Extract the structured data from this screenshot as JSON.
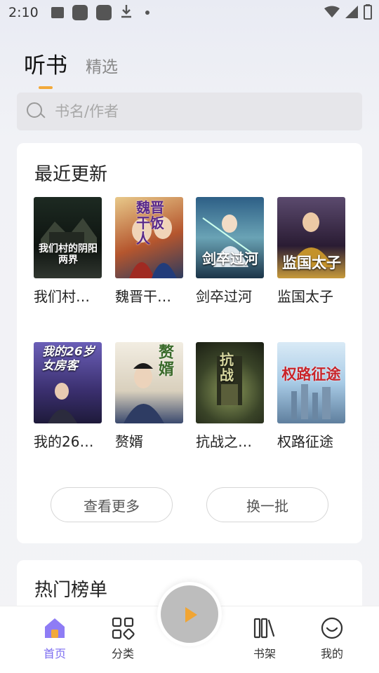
{
  "status_bar": {
    "time": "2:10"
  },
  "tabs": [
    {
      "label": "听书",
      "active": true
    },
    {
      "label": "精选",
      "active": false
    }
  ],
  "search": {
    "placeholder": "书名/作者"
  },
  "recent": {
    "title": "最近更新",
    "books": [
      {
        "title": "我们村…",
        "cover_text": "我们村的阴阳两界",
        "cover_color": "#2a2e2a"
      },
      {
        "title": "魏晋干…",
        "cover_text": "魏晋干饭人",
        "cover_color": "#c9853a"
      },
      {
        "title": "剑卒过河",
        "cover_text": "剑卒过河",
        "cover_color": "#3d6f8a"
      },
      {
        "title": "监国太子",
        "cover_text": "监国太子",
        "cover_color": "#3a2a4a"
      },
      {
        "title": "我的26…",
        "cover_text": "我的26岁女房客",
        "cover_color": "#4a3e7a"
      },
      {
        "title": "赘婿",
        "cover_text": "赘婿",
        "cover_color": "#d9d3c6"
      },
      {
        "title": "抗战之…",
        "cover_text": "抗战",
        "cover_color": "#4e5a3a"
      },
      {
        "title": "权路征途",
        "cover_text": "权路征途",
        "cover_color": "#9cc3e0"
      }
    ],
    "more_label": "查看更多",
    "refresh_label": "换一批"
  },
  "hot": {
    "title": "热门榜单"
  },
  "nav": [
    {
      "label": "首页",
      "icon": "home-icon",
      "active": true
    },
    {
      "label": "分类",
      "icon": "category-icon",
      "active": false
    },
    {
      "label": "书架",
      "icon": "bookshelf-icon",
      "active": false
    },
    {
      "label": "我的",
      "icon": "profile-icon",
      "active": false
    }
  ],
  "colors": {
    "accent": "#f2a93b",
    "nav_active": "#7c6cf0"
  }
}
